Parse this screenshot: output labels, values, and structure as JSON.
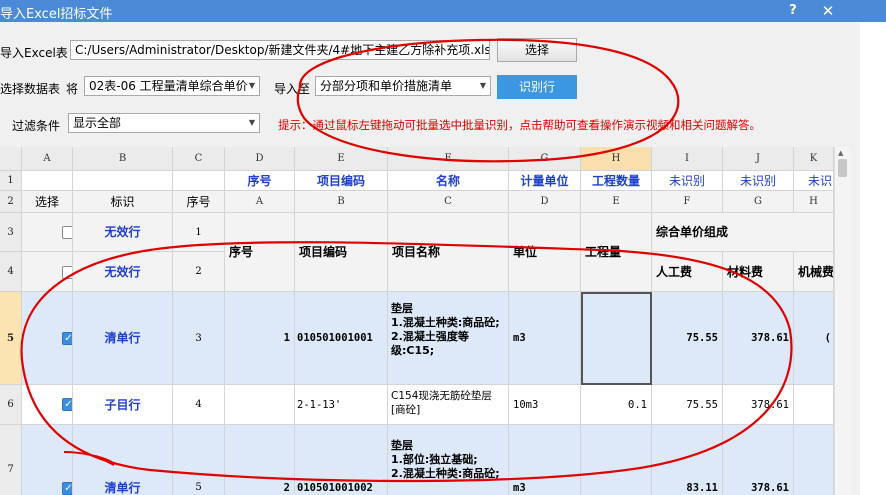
{
  "window": {
    "title": "导入Excel招标文件",
    "help_label": "?",
    "close_label": "✕"
  },
  "file": {
    "label": "导入Excel表",
    "path": "C:/Users/Administrator/Desktop/新建文件夹/4#地下主建乙方除补充项.xls",
    "browse_label": "选择"
  },
  "sheet": {
    "label": "选择数据表",
    "prefix": "将",
    "value": "02表-06 工程量清单综合单价",
    "import_to_label": "导入至",
    "import_to_value": "分部分项和单价措施清单",
    "recognize_label": "识别行"
  },
  "filter": {
    "label": "过滤条件",
    "value": "显示全部",
    "hint": "提示：通过鼠标左键拖动可批量选中批量识别，点击帮助可查看操作演示视频和相关问题解答。"
  },
  "grid": {
    "col_letters": [
      "A",
      "B",
      "C",
      "D",
      "E",
      "F",
      "G",
      "H",
      "I",
      "J",
      "K"
    ],
    "row1": {
      "seq": "序号",
      "code": "项目编码",
      "name": "名称",
      "unit": "计量单位",
      "qty": "工程数量",
      "i": "未识别",
      "j": "未识别",
      "k": "未识"
    },
    "row2": {
      "select": "选择",
      "tag": "标识",
      "num": "序号",
      "d": "A",
      "e": "B",
      "f": "C",
      "g": "D",
      "h": "E",
      "i": "F",
      "j": "G",
      "k": "H"
    },
    "row_numbers": [
      "1",
      "2",
      "3",
      "4",
      "5",
      "6",
      "7"
    ],
    "rows": [
      {
        "checked": false,
        "tag": "无效行",
        "num": "1",
        "seq": "序号",
        "code": "项目编码",
        "name": "项目名称",
        "unit": "单位",
        "qty": "工程量",
        "group": "综合单价组成"
      },
      {
        "checked": false,
        "tag": "无效行",
        "num": "2",
        "i": "人工费",
        "j": "材料费",
        "k": "机械费"
      },
      {
        "checked": true,
        "tag": "清单行",
        "num": "3",
        "seq": "1",
        "code": "010501001001",
        "name": "垫层\n1.混凝土种类:商品砼;\n2.混凝土强度等级:C15;",
        "unit": "m3",
        "qty": "",
        "i": "75.55",
        "j": "378.61",
        "k": "("
      },
      {
        "checked": true,
        "tag": "子目行",
        "num": "4",
        "code": "2-1-13'",
        "name": "C154现浇无筋砼垫层[商砼]",
        "unit": "10m3",
        "qty": "0.1",
        "i": "75.55",
        "j": "378.61"
      },
      {
        "checked": true,
        "tag": "清单行",
        "num": "5",
        "seq": "2",
        "code": "010501001002",
        "name": "垫层\n1.部位:独立基础;\n2.混凝土种类:商品砼;",
        "unit": "m3",
        "i": "83.11",
        "j": "378.61"
      }
    ]
  },
  "colors": {
    "titlebar": "#4a8ad6",
    "accent_button": "#3c97e2",
    "hint": "#e00000",
    "label_blue": "#1f3fcf",
    "selected_row": "#dde9f8",
    "annotation": "#e00000"
  },
  "icons": {
    "dropdown": "chevron-down-icon",
    "checkbox": "checkbox-icon"
  }
}
